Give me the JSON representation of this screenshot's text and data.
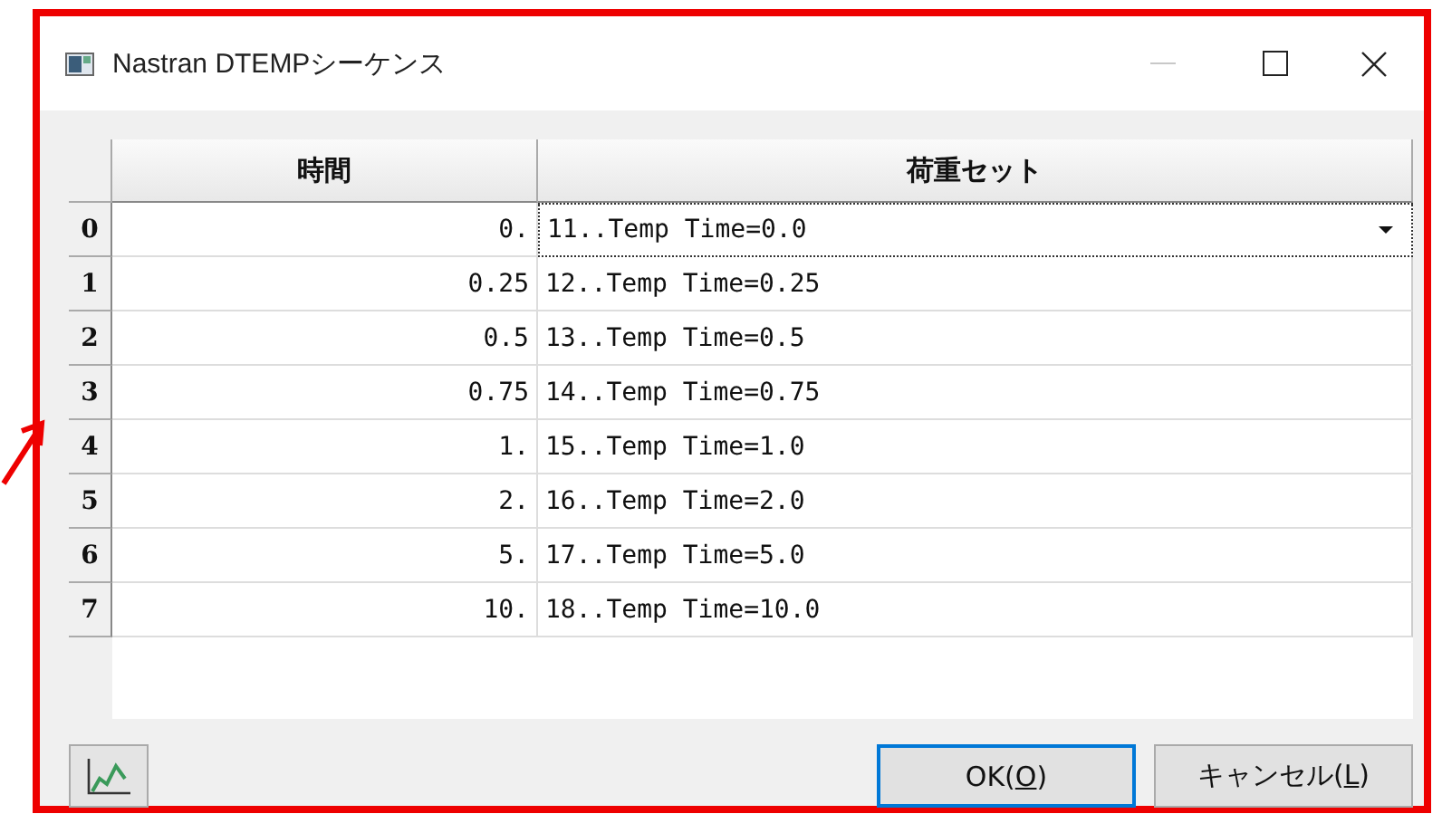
{
  "window": {
    "title": "Nastran DTEMPシーケンス"
  },
  "table": {
    "columns": [
      "時間",
      "荷重セット"
    ],
    "rows": [
      {
        "header": "0",
        "time": "0.",
        "load_set": "11..Temp Time=0.0",
        "focused": true
      },
      {
        "header": "1",
        "time": "0.25",
        "load_set": "12..Temp Time=0.25",
        "focused": false
      },
      {
        "header": "2",
        "time": "0.5",
        "load_set": "13..Temp Time=0.5",
        "focused": false
      },
      {
        "header": "3",
        "time": "0.75",
        "load_set": "14..Temp Time=0.75",
        "focused": false
      },
      {
        "header": "4",
        "time": "1.",
        "load_set": "15..Temp Time=1.0",
        "focused": false
      },
      {
        "header": "5",
        "time": "2.",
        "load_set": "16..Temp Time=2.0",
        "focused": false
      },
      {
        "header": "6",
        "time": "5.",
        "load_set": "17..Temp Time=5.0",
        "focused": false
      },
      {
        "header": "7",
        "time": "10.",
        "load_set": "18..Temp Time=10.0",
        "focused": false
      }
    ]
  },
  "buttons": [
    {
      "before": "OK(",
      "access_key": "O",
      "after": ")",
      "default": true
    },
    {
      "before": "キャンセル(",
      "access_key": "L",
      "after": ")",
      "default": false
    }
  ]
}
